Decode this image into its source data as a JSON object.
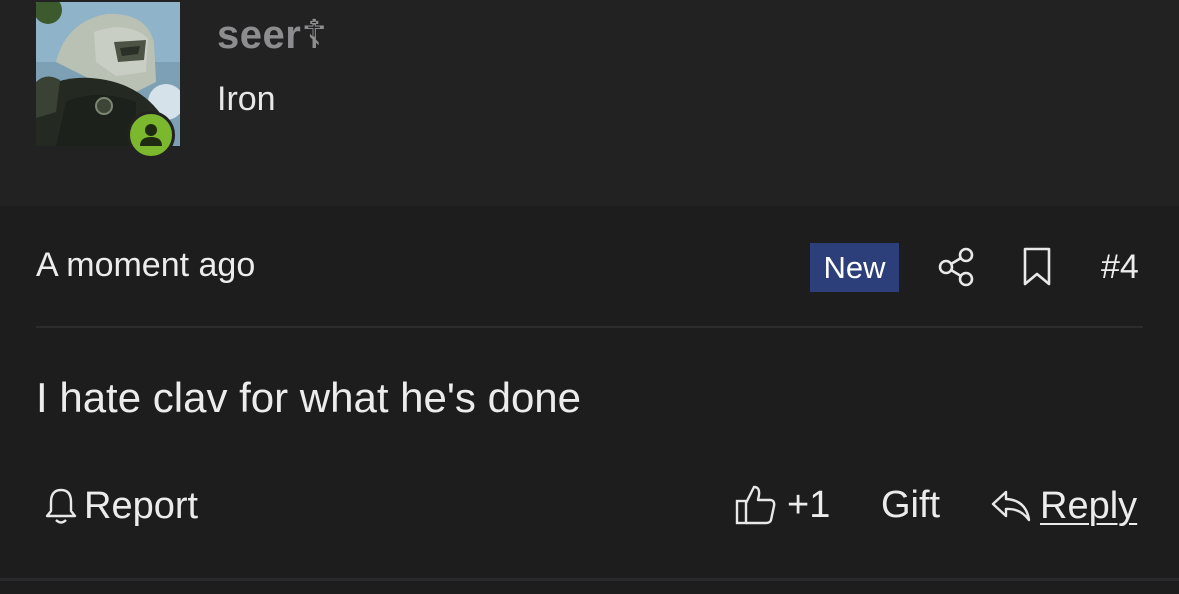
{
  "user": {
    "username": "seer☦",
    "title": "Iron",
    "status": "online"
  },
  "post": {
    "time": "A moment ago",
    "badge": "New",
    "number": "#4",
    "body": "I hate clav for what he's done"
  },
  "actions": {
    "report": "Report",
    "likes": "+1",
    "gift": "Gift",
    "reply": "Reply"
  },
  "icons": {
    "share": "share-icon",
    "bookmark": "bookmark-icon",
    "bell": "bell-icon",
    "thumbs_up": "thumbs-up-icon",
    "reply": "reply-arrow-icon",
    "status": "user-status-icon"
  },
  "colors": {
    "background": "#1d1d1e",
    "header_background": "#222223",
    "badge_new": "#2d3f7a",
    "status_online": "#7bb82e",
    "username": "#8d8d8f"
  }
}
